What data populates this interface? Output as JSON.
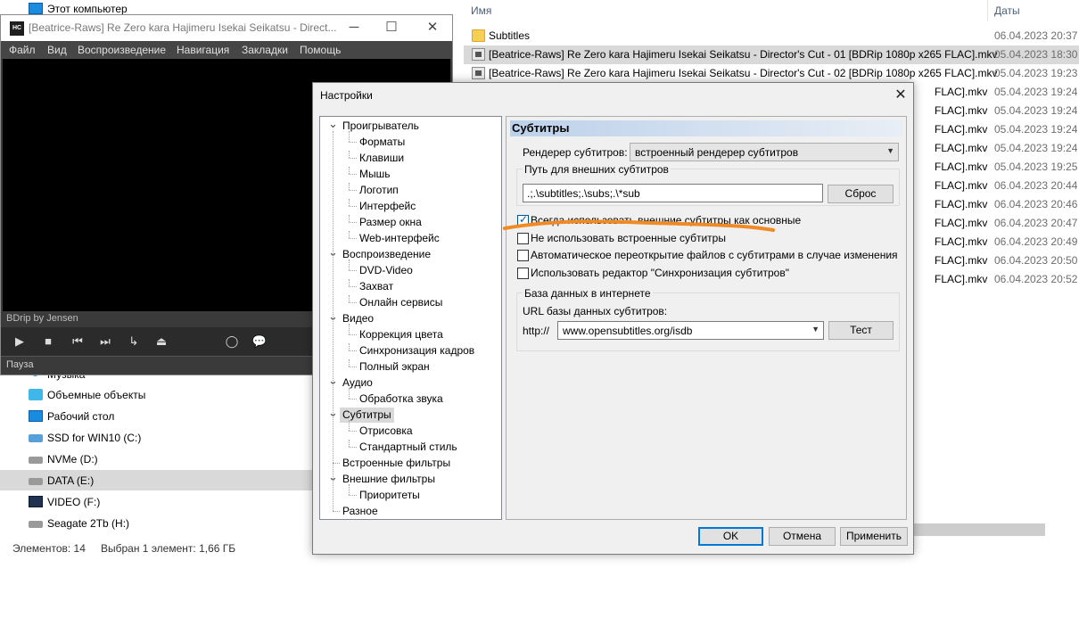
{
  "explorer": {
    "columns": {
      "name": "Имя",
      "date": "Даты"
    },
    "files": [
      {
        "name": "Subtitles",
        "date": "06.04.2023 20:37",
        "type": "folder"
      },
      {
        "name": "[Beatrice-Raws] Re Zero kara Hajimeru Isekai Seikatsu - Director's Cut - 01 [BDRip 1080p x265 FLAC].mkv",
        "date": "05.04.2023 18:30",
        "type": "video"
      },
      {
        "name": "[Beatrice-Raws] Re Zero kara Hajimeru Isekai Seikatsu - Director's Cut - 02 [BDRip 1080p x265 FLAC].mkv",
        "date": "05.04.2023 19:23",
        "type": "video"
      },
      {
        "name": "FLAC].mkv",
        "date": "05.04.2023 19:24",
        "type": "video"
      },
      {
        "name": "FLAC].mkv",
        "date": "05.04.2023 19:24",
        "type": "video"
      },
      {
        "name": "FLAC].mkv",
        "date": "05.04.2023 19:24",
        "type": "video"
      },
      {
        "name": "FLAC].mkv",
        "date": "05.04.2023 19:24",
        "type": "video"
      },
      {
        "name": "FLAC].mkv",
        "date": "05.04.2023 19:25",
        "type": "video"
      },
      {
        "name": "FLAC].mkv",
        "date": "06.04.2023 20:44",
        "type": "video"
      },
      {
        "name": "FLAC].mkv",
        "date": "06.04.2023 20:46",
        "type": "video"
      },
      {
        "name": "FLAC].mkv",
        "date": "06.04.2023 20:47",
        "type": "video"
      },
      {
        "name": "FLAC].mkv",
        "date": "06.04.2023 20:49",
        "type": "video"
      },
      {
        "name": "FLAC].mkv",
        "date": "06.04.2023 20:50",
        "type": "video"
      },
      {
        "name": "FLAC].mkv",
        "date": "06.04.2023 20:52",
        "type": "video"
      }
    ],
    "nav": {
      "top": "Этот компьютер",
      "items": [
        {
          "label": "Музыка",
          "icon": "music-icon"
        },
        {
          "label": "Объемные объекты",
          "icon": "3d-objects-icon"
        },
        {
          "label": "Рабочий стол",
          "icon": "desktop-icon"
        },
        {
          "label": "SSD for WIN10 (C:)",
          "icon": "drive-os-icon"
        },
        {
          "label": "NVMe (D:)",
          "icon": "drive-icon"
        },
        {
          "label": "DATA (E:)",
          "icon": "drive-icon"
        },
        {
          "label": "VIDEO (F:)",
          "icon": "video-drive-icon"
        },
        {
          "label": "Seagate 2Tb (H:)",
          "icon": "drive-icon"
        }
      ]
    },
    "status": {
      "count": "Элементов: 14",
      "selected": "Выбран 1 элемент: 1,66 ГБ"
    }
  },
  "player": {
    "title": "[Beatrice-Raws] Re Zero kara Hajimeru Isekai Seikatsu - Direct...",
    "menu": [
      "Файл",
      "Вид",
      "Воспроизведение",
      "Навигация",
      "Закладки",
      "Помощь"
    ],
    "info": "BDrip by Jensen",
    "status": "Пауза"
  },
  "dialog": {
    "title": "Настройки",
    "tree": [
      {
        "label": "Проигрыватель",
        "level": 0,
        "expanded": true
      },
      {
        "label": "Форматы",
        "level": 1
      },
      {
        "label": "Клавиши",
        "level": 1
      },
      {
        "label": "Мышь",
        "level": 1
      },
      {
        "label": "Логотип",
        "level": 1
      },
      {
        "label": "Интерфейс",
        "level": 1
      },
      {
        "label": "Размер окна",
        "level": 1
      },
      {
        "label": "Web-интерфейс",
        "level": 1
      },
      {
        "label": "Воспроизведение",
        "level": 0,
        "expanded": true
      },
      {
        "label": "DVD-Video",
        "level": 1
      },
      {
        "label": "Захват",
        "level": 1
      },
      {
        "label": "Онлайн сервисы",
        "level": 1
      },
      {
        "label": "Видео",
        "level": 0,
        "expanded": true
      },
      {
        "label": "Коррекция цвета",
        "level": 1
      },
      {
        "label": "Синхронизация кадров",
        "level": 1
      },
      {
        "label": "Полный экран",
        "level": 1
      },
      {
        "label": "Аудио",
        "level": 0,
        "expanded": true
      },
      {
        "label": "Обработка звука",
        "level": 1
      },
      {
        "label": "Субтитры",
        "level": 0,
        "expanded": true,
        "selected": true
      },
      {
        "label": "Отрисовка",
        "level": 1
      },
      {
        "label": "Стандартный стиль",
        "level": 1
      },
      {
        "label": "Встроенные фильтры",
        "level": 0
      },
      {
        "label": "Внешние фильтры",
        "level": 0,
        "expanded": true
      },
      {
        "label": "Приоритеты",
        "level": 1
      },
      {
        "label": "Разное",
        "level": 0
      }
    ],
    "panel": {
      "heading": "Субтитры",
      "renderer_label": "Рендерер субтитров:",
      "renderer_value": "встроенный рендерер субтитров",
      "ext_path_group": "Путь для внешних субтитров",
      "ext_path_value": ".;.\\subtitles;.\\subs;.\\*sub",
      "reset_button": "Сброс",
      "checkboxes": [
        {
          "label": "Всегда использовать внешние субтитры как основные",
          "checked": true
        },
        {
          "label": "Не использовать встроенные субтитры",
          "checked": false
        },
        {
          "label": "Автоматическое переоткрытие файлов с субтитрами в случае изменения",
          "checked": false
        },
        {
          "label": "Использовать редактор \"Синхронизация субтитров\"",
          "checked": false
        }
      ],
      "db_group": "База данных в интернете",
      "db_url_label": "URL базы данных субтитров:",
      "db_prefix": "http://",
      "db_url_value": "www.opensubtitles.org/isdb",
      "test_button": "Тест"
    },
    "buttons": {
      "ok": "OK",
      "cancel": "Отмена",
      "apply": "Применить"
    }
  },
  "colors": {
    "annotation": "#f08a24",
    "selection": "#d9d9d9",
    "accent": "#0078d7"
  }
}
